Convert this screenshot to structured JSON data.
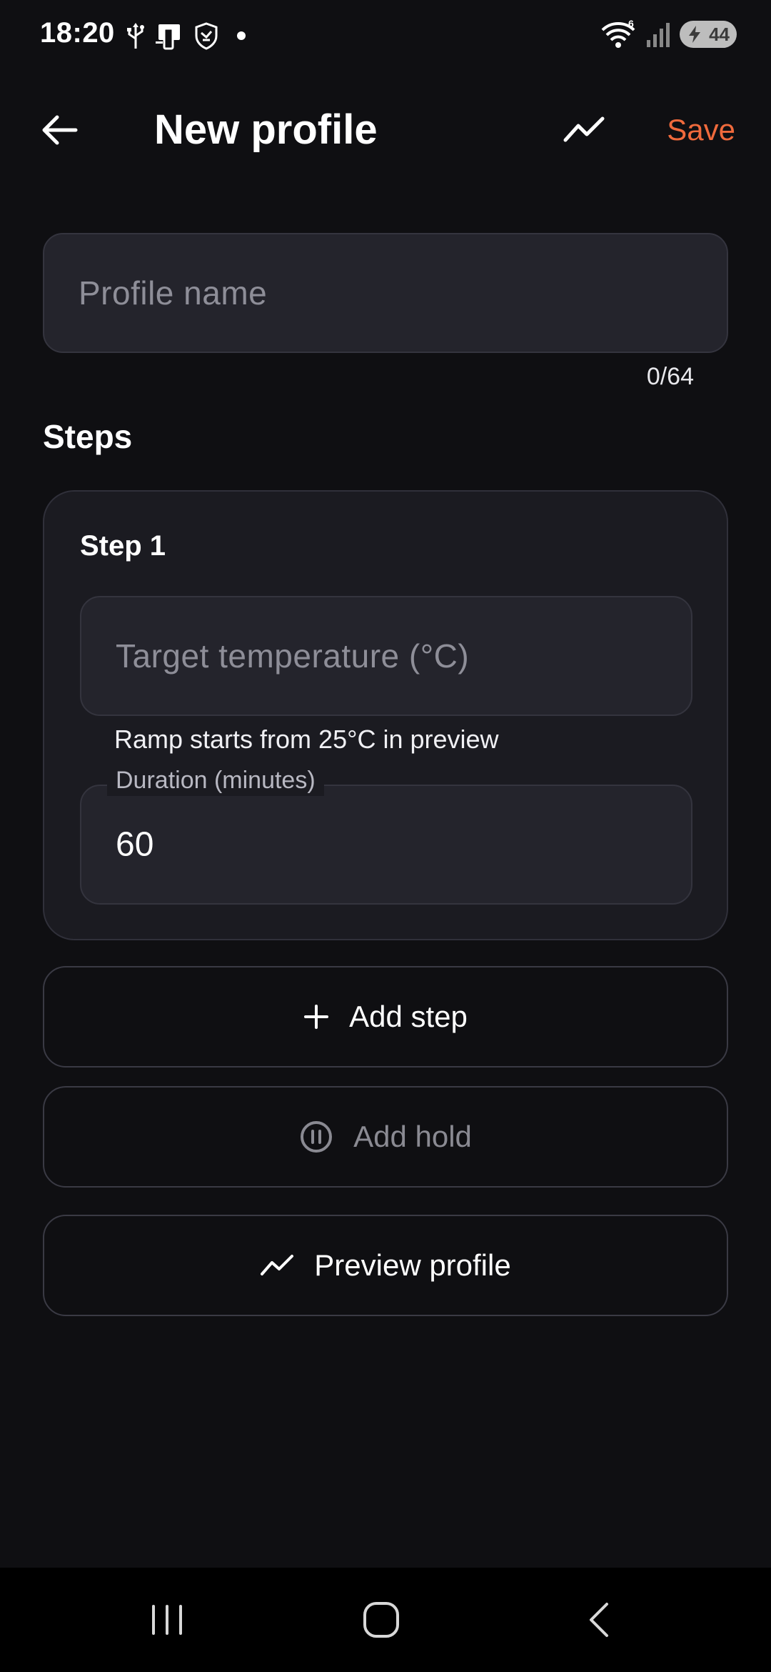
{
  "status_bar": {
    "time": "18:20",
    "battery_level": "44",
    "icons": [
      "usb-icon",
      "phone-link-icon",
      "shield-icon",
      "notification-dot",
      "wifi-icon",
      "signal-icon",
      "battery-charging-icon"
    ],
    "wifi_badge": "6"
  },
  "app_bar": {
    "title": "New profile",
    "back_icon": "arrow-left-icon",
    "chart_icon": "trend-line-icon",
    "save_label": "Save"
  },
  "profile_name": {
    "placeholder": "Profile name",
    "value": "",
    "counter": "0/64"
  },
  "steps_section": {
    "title": "Steps",
    "steps": [
      {
        "title": "Step 1",
        "target_temperature": {
          "placeholder": "Target temperature (°C)",
          "value": ""
        },
        "helper_text": "Ramp starts from 25°C in preview",
        "duration": {
          "label": "Duration (minutes)",
          "value": "60"
        }
      }
    ]
  },
  "actions": {
    "add_step": {
      "label": "Add step",
      "icon": "plus-icon"
    },
    "add_hold": {
      "label": "Add hold",
      "icon": "pause-circle-icon",
      "disabled": true
    },
    "preview": {
      "label": "Preview profile",
      "icon": "trend-line-icon"
    }
  },
  "nav_bar": {
    "buttons": [
      "recents-icon",
      "home-icon",
      "back-icon"
    ]
  },
  "colors": {
    "background": "#0f0f12",
    "accent": "#f06a3c",
    "field_bg": "#24242c",
    "card_bg": "#1b1b21",
    "disabled_text": "#8a8a92"
  }
}
